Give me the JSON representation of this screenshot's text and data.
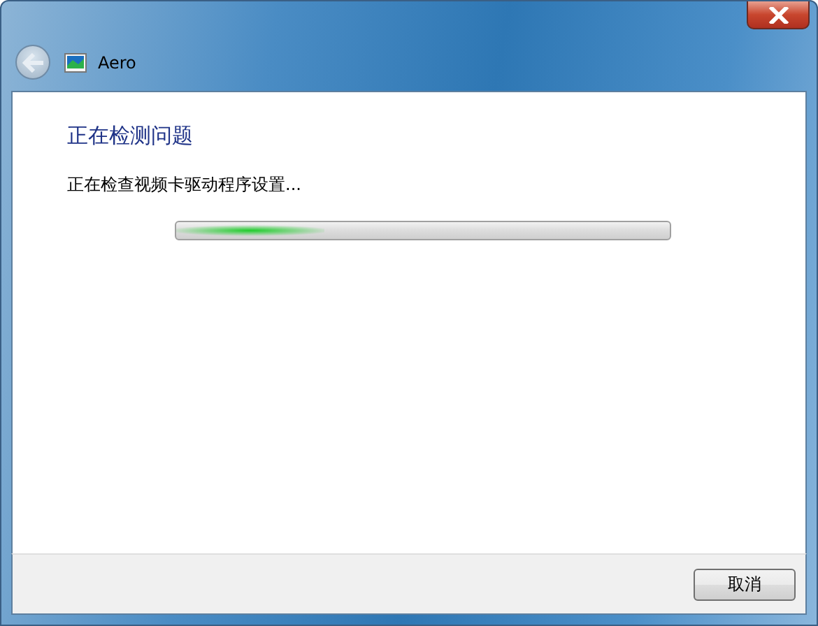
{
  "window": {
    "title": "Aero"
  },
  "heading": "正在检测问题",
  "status_text": "正在检查视频卡驱动程序设置...",
  "progress": {
    "kind": "marquee",
    "level": 0.3
  },
  "buttons": [
    {
      "label": "取消"
    }
  ]
}
